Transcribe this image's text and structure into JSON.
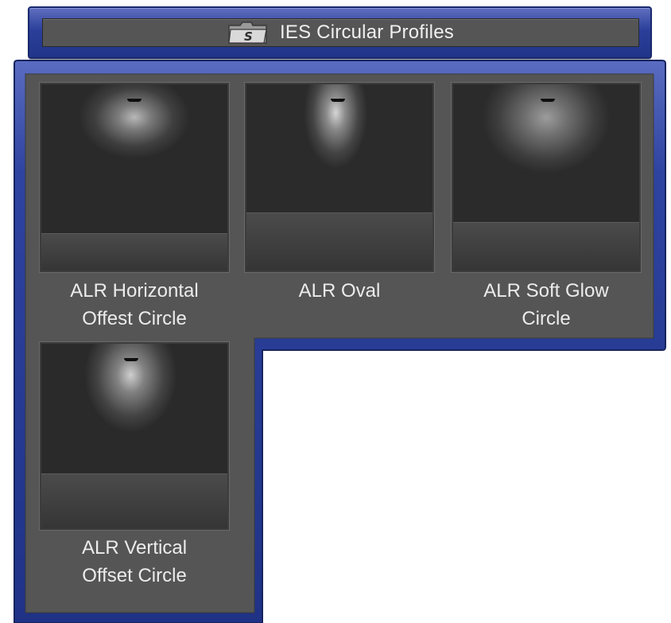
{
  "window": {
    "title": "IES Circular Profiles",
    "icon": "s-folder-icon"
  },
  "colors": {
    "frame_blue": "#2b3f9a",
    "panel_gray": "#555555",
    "label_text": "#ececec"
  },
  "profiles": [
    {
      "label_line1": "ALR Horizontal",
      "label_line2": "Offest Circle"
    },
    {
      "label_line1": "ALR Oval",
      "label_line2": ""
    },
    {
      "label_line1": "ALR Soft Glow",
      "label_line2": "Circle"
    },
    {
      "label_line1": "ALR Vertical",
      "label_line2": "Offset Circle"
    }
  ]
}
